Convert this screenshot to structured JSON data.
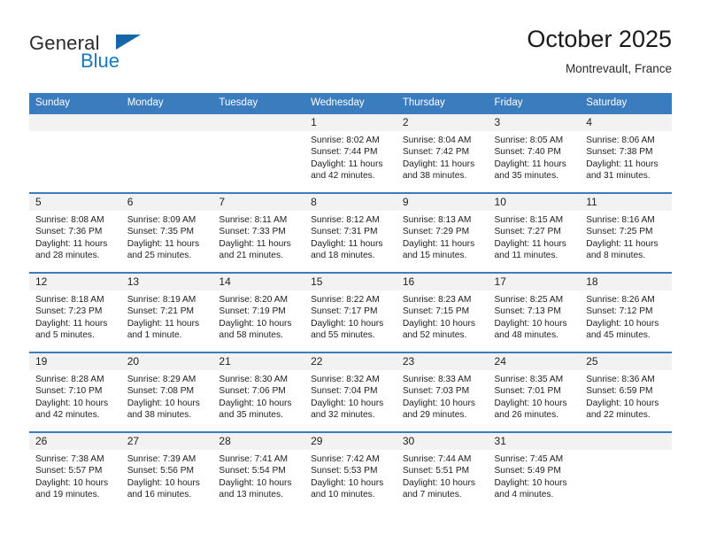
{
  "brand": {
    "line1": "General",
    "line2": "Blue",
    "triangle_color": "#1565a8",
    "text_color": "#2b2b2b",
    "blue_text_color": "#1877c4"
  },
  "header": {
    "title": "October 2025",
    "subtitle": "Montrevault, France"
  },
  "theme": {
    "header_row_bg": "#3a7cbe",
    "header_row_text": "#ffffff",
    "daynum_bg": "#f2f2f2",
    "cell_bg": "#ffffff",
    "week_divider": "#3a7cbe"
  },
  "weekdays": [
    "Sunday",
    "Monday",
    "Tuesday",
    "Wednesday",
    "Thursday",
    "Friday",
    "Saturday"
  ],
  "labels": {
    "sunrise": "Sunrise:",
    "sunset": "Sunset:",
    "daylight": "Daylight:"
  },
  "weeks": [
    [
      {
        "day": "",
        "sunrise": "",
        "sunset": "",
        "daylight": ""
      },
      {
        "day": "",
        "sunrise": "",
        "sunset": "",
        "daylight": ""
      },
      {
        "day": "",
        "sunrise": "",
        "sunset": "",
        "daylight": ""
      },
      {
        "day": "1",
        "sunrise": "Sunrise: 8:02 AM",
        "sunset": "Sunset: 7:44 PM",
        "daylight": "Daylight: 11 hours and 42 minutes."
      },
      {
        "day": "2",
        "sunrise": "Sunrise: 8:04 AM",
        "sunset": "Sunset: 7:42 PM",
        "daylight": "Daylight: 11 hours and 38 minutes."
      },
      {
        "day": "3",
        "sunrise": "Sunrise: 8:05 AM",
        "sunset": "Sunset: 7:40 PM",
        "daylight": "Daylight: 11 hours and 35 minutes."
      },
      {
        "day": "4",
        "sunrise": "Sunrise: 8:06 AM",
        "sunset": "Sunset: 7:38 PM",
        "daylight": "Daylight: 11 hours and 31 minutes."
      }
    ],
    [
      {
        "day": "5",
        "sunrise": "Sunrise: 8:08 AM",
        "sunset": "Sunset: 7:36 PM",
        "daylight": "Daylight: 11 hours and 28 minutes."
      },
      {
        "day": "6",
        "sunrise": "Sunrise: 8:09 AM",
        "sunset": "Sunset: 7:35 PM",
        "daylight": "Daylight: 11 hours and 25 minutes."
      },
      {
        "day": "7",
        "sunrise": "Sunrise: 8:11 AM",
        "sunset": "Sunset: 7:33 PM",
        "daylight": "Daylight: 11 hours and 21 minutes."
      },
      {
        "day": "8",
        "sunrise": "Sunrise: 8:12 AM",
        "sunset": "Sunset: 7:31 PM",
        "daylight": "Daylight: 11 hours and 18 minutes."
      },
      {
        "day": "9",
        "sunrise": "Sunrise: 8:13 AM",
        "sunset": "Sunset: 7:29 PM",
        "daylight": "Daylight: 11 hours and 15 minutes."
      },
      {
        "day": "10",
        "sunrise": "Sunrise: 8:15 AM",
        "sunset": "Sunset: 7:27 PM",
        "daylight": "Daylight: 11 hours and 11 minutes."
      },
      {
        "day": "11",
        "sunrise": "Sunrise: 8:16 AM",
        "sunset": "Sunset: 7:25 PM",
        "daylight": "Daylight: 11 hours and 8 minutes."
      }
    ],
    [
      {
        "day": "12",
        "sunrise": "Sunrise: 8:18 AM",
        "sunset": "Sunset: 7:23 PM",
        "daylight": "Daylight: 11 hours and 5 minutes."
      },
      {
        "day": "13",
        "sunrise": "Sunrise: 8:19 AM",
        "sunset": "Sunset: 7:21 PM",
        "daylight": "Daylight: 11 hours and 1 minute."
      },
      {
        "day": "14",
        "sunrise": "Sunrise: 8:20 AM",
        "sunset": "Sunset: 7:19 PM",
        "daylight": "Daylight: 10 hours and 58 minutes."
      },
      {
        "day": "15",
        "sunrise": "Sunrise: 8:22 AM",
        "sunset": "Sunset: 7:17 PM",
        "daylight": "Daylight: 10 hours and 55 minutes."
      },
      {
        "day": "16",
        "sunrise": "Sunrise: 8:23 AM",
        "sunset": "Sunset: 7:15 PM",
        "daylight": "Daylight: 10 hours and 52 minutes."
      },
      {
        "day": "17",
        "sunrise": "Sunrise: 8:25 AM",
        "sunset": "Sunset: 7:13 PM",
        "daylight": "Daylight: 10 hours and 48 minutes."
      },
      {
        "day": "18",
        "sunrise": "Sunrise: 8:26 AM",
        "sunset": "Sunset: 7:12 PM",
        "daylight": "Daylight: 10 hours and 45 minutes."
      }
    ],
    [
      {
        "day": "19",
        "sunrise": "Sunrise: 8:28 AM",
        "sunset": "Sunset: 7:10 PM",
        "daylight": "Daylight: 10 hours and 42 minutes."
      },
      {
        "day": "20",
        "sunrise": "Sunrise: 8:29 AM",
        "sunset": "Sunset: 7:08 PM",
        "daylight": "Daylight: 10 hours and 38 minutes."
      },
      {
        "day": "21",
        "sunrise": "Sunrise: 8:30 AM",
        "sunset": "Sunset: 7:06 PM",
        "daylight": "Daylight: 10 hours and 35 minutes."
      },
      {
        "day": "22",
        "sunrise": "Sunrise: 8:32 AM",
        "sunset": "Sunset: 7:04 PM",
        "daylight": "Daylight: 10 hours and 32 minutes."
      },
      {
        "day": "23",
        "sunrise": "Sunrise: 8:33 AM",
        "sunset": "Sunset: 7:03 PM",
        "daylight": "Daylight: 10 hours and 29 minutes."
      },
      {
        "day": "24",
        "sunrise": "Sunrise: 8:35 AM",
        "sunset": "Sunset: 7:01 PM",
        "daylight": "Daylight: 10 hours and 26 minutes."
      },
      {
        "day": "25",
        "sunrise": "Sunrise: 8:36 AM",
        "sunset": "Sunset: 6:59 PM",
        "daylight": "Daylight: 10 hours and 22 minutes."
      }
    ],
    [
      {
        "day": "26",
        "sunrise": "Sunrise: 7:38 AM",
        "sunset": "Sunset: 5:57 PM",
        "daylight": "Daylight: 10 hours and 19 minutes."
      },
      {
        "day": "27",
        "sunrise": "Sunrise: 7:39 AM",
        "sunset": "Sunset: 5:56 PM",
        "daylight": "Daylight: 10 hours and 16 minutes."
      },
      {
        "day": "28",
        "sunrise": "Sunrise: 7:41 AM",
        "sunset": "Sunset: 5:54 PM",
        "daylight": "Daylight: 10 hours and 13 minutes."
      },
      {
        "day": "29",
        "sunrise": "Sunrise: 7:42 AM",
        "sunset": "Sunset: 5:53 PM",
        "daylight": "Daylight: 10 hours and 10 minutes."
      },
      {
        "day": "30",
        "sunrise": "Sunrise: 7:44 AM",
        "sunset": "Sunset: 5:51 PM",
        "daylight": "Daylight: 10 hours and 7 minutes."
      },
      {
        "day": "31",
        "sunrise": "Sunrise: 7:45 AM",
        "sunset": "Sunset: 5:49 PM",
        "daylight": "Daylight: 10 hours and 4 minutes."
      },
      {
        "day": "",
        "sunrise": "",
        "sunset": "",
        "daylight": ""
      }
    ]
  ]
}
